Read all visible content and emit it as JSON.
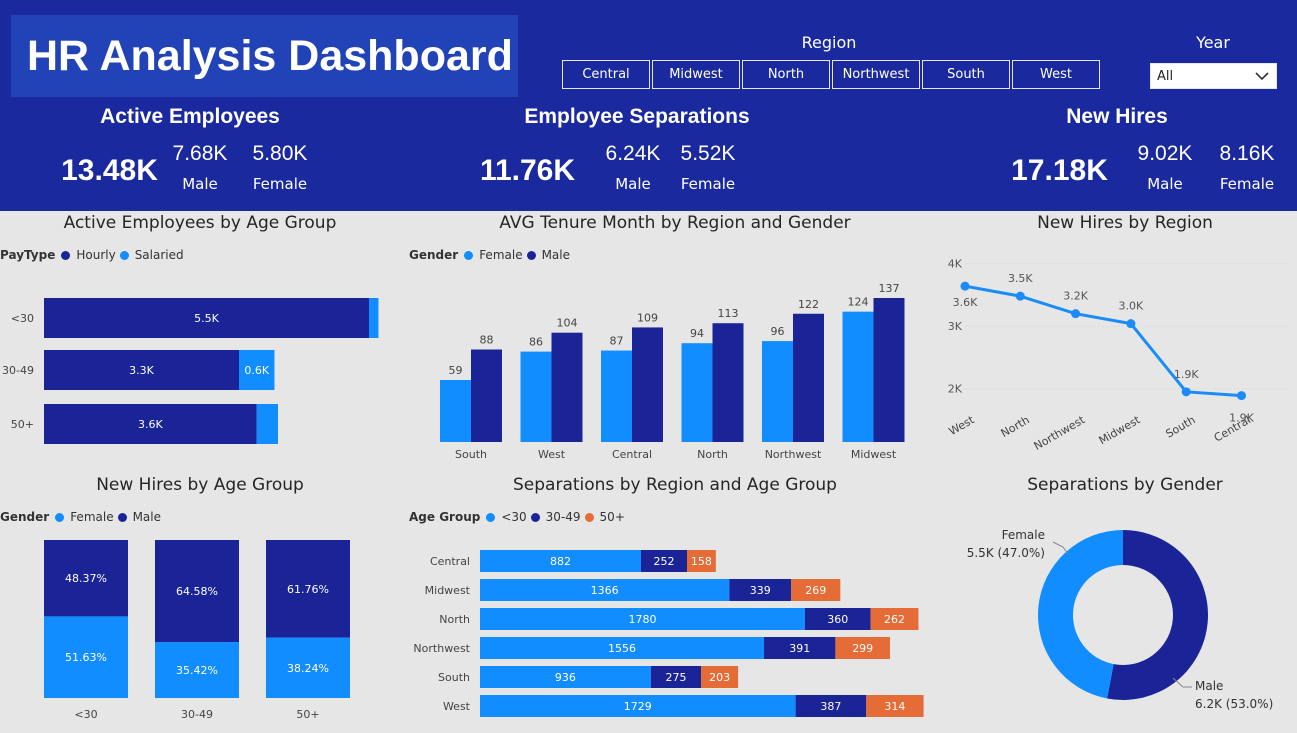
{
  "colors": {
    "header": "#1a2a9e",
    "title_box": "#2243b8",
    "dark_blue": "#1a2496",
    "light_blue": "#118dff",
    "orange": "#e66c37",
    "line": "#1b8cf7"
  },
  "header": {
    "title": "HR Analysis Dashboard"
  },
  "region_slicer": {
    "label": "Region",
    "options": [
      "Central",
      "Midwest",
      "North",
      "Northwest",
      "South",
      "West"
    ]
  },
  "year_slicer": {
    "label": "Year",
    "selected": "All",
    "icon": "chevron-down-icon"
  },
  "kpis": {
    "active": {
      "title": "Active Employees",
      "total": "13.48K",
      "male": "7.68K",
      "female": "5.80K",
      "male_label": "Male",
      "female_label": "Female"
    },
    "separations": {
      "title": "Employee Separations",
      "total": "11.76K",
      "male": "6.24K",
      "female": "5.52K",
      "male_label": "Male",
      "female_label": "Female"
    },
    "hires": {
      "title": "New Hires",
      "total": "17.18K",
      "male": "9.02K",
      "female": "8.16K",
      "male_label": "Male",
      "female_label": "Female"
    }
  },
  "chart_data": [
    {
      "id": "active_by_age",
      "type": "bar",
      "orientation": "horizontal",
      "stacked": true,
      "title": "Active Employees by Age Group",
      "legend_title": "PayType",
      "categories": [
        "<30",
        "30-49",
        "50+"
      ],
      "series": [
        {
          "name": "Hourly",
          "values": [
            5500,
            3300,
            3600
          ],
          "labels": [
            "5.5K",
            "3.3K",
            "3.6K"
          ]
        },
        {
          "name": "Salaried",
          "values": [
            160,
            600,
            360
          ],
          "labels": [
            "",
            "0.6K",
            ""
          ]
        }
      ]
    },
    {
      "id": "tenure_by_region",
      "type": "bar",
      "title": "AVG Tenure Month by Region and Gender",
      "legend_title": "Gender",
      "categories": [
        "South",
        "West",
        "Central",
        "North",
        "Northwest",
        "Midwest"
      ],
      "series": [
        {
          "name": "Female",
          "values": [
            59,
            86,
            87,
            94,
            96,
            124
          ]
        },
        {
          "name": "Male",
          "values": [
            88,
            104,
            109,
            113,
            122,
            137
          ]
        }
      ]
    },
    {
      "id": "hires_by_region",
      "type": "line",
      "title": "New Hires by Region",
      "categories": [
        "West",
        "North",
        "Northwest",
        "Midwest",
        "South",
        "Central"
      ],
      "values": [
        3640,
        3480,
        3200,
        3040,
        1950,
        1890
      ],
      "labels": [
        "3.6K",
        "3.5K",
        "3.2K",
        "3.0K",
        "1.9K",
        "1.9K"
      ],
      "yticks": [
        "4K",
        "3K",
        "2K"
      ],
      "ylim": [
        1500,
        4250
      ]
    },
    {
      "id": "hires_by_age",
      "type": "bar",
      "stacked": true,
      "percent": true,
      "title": "New Hires by Age Group",
      "legend_title": "Gender",
      "categories": [
        "<30",
        "30-49",
        "50+"
      ],
      "series": [
        {
          "name": "Female",
          "values": [
            51.63,
            35.42,
            38.24
          ],
          "labels": [
            "51.63%",
            "35.42%",
            "38.24%"
          ]
        },
        {
          "name": "Male",
          "values": [
            48.37,
            64.58,
            61.76
          ],
          "labels": [
            "48.37%",
            "64.58%",
            "61.76%"
          ]
        }
      ]
    },
    {
      "id": "separations_by_region_age",
      "type": "bar",
      "orientation": "horizontal",
      "stacked": true,
      "title": "Separations by Region and Age Group",
      "legend_title": "Age Group",
      "categories": [
        "Central",
        "Midwest",
        "North",
        "Northwest",
        "South",
        "West"
      ],
      "series": [
        {
          "name": "<30",
          "values": [
            882,
            1366,
            1780,
            1556,
            936,
            1729
          ]
        },
        {
          "name": "30-49",
          "values": [
            252,
            339,
            360,
            391,
            275,
            387
          ]
        },
        {
          "name": "50+",
          "values": [
            158,
            269,
            262,
            299,
            203,
            314
          ]
        }
      ]
    },
    {
      "id": "separations_by_gender",
      "type": "pie",
      "donut": true,
      "title": "Separations by Gender",
      "slices": [
        {
          "name": "Female",
          "value": 47.0,
          "label": "5.5K (47.0%)"
        },
        {
          "name": "Male",
          "value": 53.0,
          "label": "6.2K (53.0%)"
        }
      ]
    }
  ]
}
